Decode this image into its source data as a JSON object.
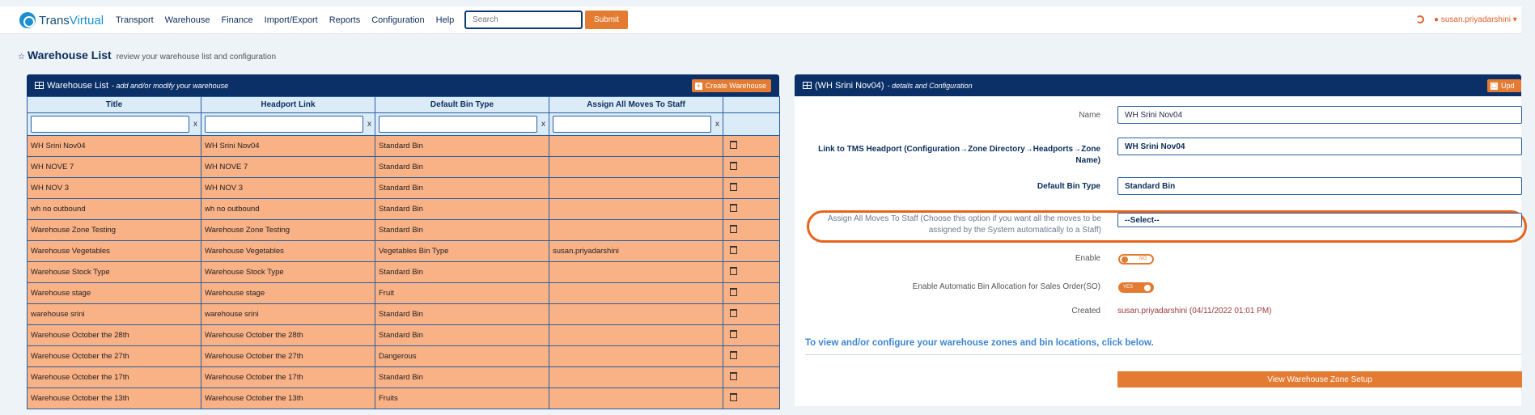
{
  "header": {
    "logo_text_a": "Trans",
    "logo_text_b": "Virtual",
    "nav": [
      "Transport",
      "Warehouse",
      "Finance",
      "Import/Export",
      "Reports",
      "Configuration",
      "Help"
    ],
    "search_placeholder": "Search",
    "submit_label": "Submit",
    "user": "susan.priyadarshini"
  },
  "page": {
    "title": "Warehouse List",
    "subtitle": "review your warehouse list and configuration"
  },
  "list_panel": {
    "title": "Warehouse List",
    "desc": "- add and/or modify your warehouse",
    "create_label": "Create Warehouse",
    "columns": [
      "Title",
      "Headport Link",
      "Default Bin Type",
      "Assign All Moves To Staff"
    ],
    "clear": "x",
    "rows": [
      [
        "WH Srini Nov04",
        "WH Srini Nov04",
        "Standard Bin",
        ""
      ],
      [
        "WH NOVE 7",
        "WH NOVE 7",
        "Standard Bin",
        ""
      ],
      [
        "WH NOV 3",
        "WH NOV 3",
        "Standard Bin",
        ""
      ],
      [
        "wh no outbound",
        "wh no outbound",
        "Standard Bin",
        ""
      ],
      [
        "Warehouse Zone Testing",
        "Warehouse Zone Testing",
        "Standard Bin",
        ""
      ],
      [
        "Warehouse Vegetables",
        "Warehouse Vegetables",
        "Vegetables Bin Type",
        "susan.priyadarshini"
      ],
      [
        "Warehouse Stock Type",
        "Warehouse Stock Type",
        "Standard Bin",
        ""
      ],
      [
        "Warehouse stage",
        "Warehouse stage",
        "Fruit",
        ""
      ],
      [
        "warehouse srini",
        "warehouse srini",
        "Standard Bin",
        ""
      ],
      [
        "Warehouse October the 28th",
        "Warehouse October the 28th",
        "Standard Bin",
        ""
      ],
      [
        "Warehouse October the 27th",
        "Warehouse October the 27th",
        "Dangerous",
        ""
      ],
      [
        "Warehouse October the 17th",
        "Warehouse October the 17th",
        "Standard Bin",
        ""
      ],
      [
        "Warehouse October the 13th",
        "Warehouse October the 13th",
        "Fruits",
        ""
      ]
    ]
  },
  "detail_panel": {
    "title": "(WH Srini Nov04)",
    "desc": "- details and Configuration",
    "update_label": "Upd",
    "name_label": "Name",
    "name_value": "WH Srini Nov04",
    "headport_label": "Link to TMS Headport (Configuration→Zone Directory→Headports→Zone Name)",
    "headport_value": "WH Srini Nov04",
    "bin_label": "Default Bin Type",
    "bin_value": "Standard Bin",
    "assign_label": "Assign All Moves To Staff (Choose this option if you want all the moves to be assigned by the System automatically to a Staff)",
    "assign_value": "--Select--",
    "enable_label": "Enable",
    "enable_state": "NO",
    "auto_label": "Enable Automatic Bin Allocation for Sales Order(SO)",
    "auto_state": "YES",
    "created_label": "Created",
    "created_value": "susan.priyadarshini (04/11/2022 01:01 PM)",
    "zones_text": "To view and/or configure your warehouse zones and bin locations, click below.",
    "zone_button": "View Warehouse Zone Setup"
  },
  "colors": {
    "navy": "#0b2f67",
    "accent": "#e47b33",
    "row": "#f9b186"
  }
}
